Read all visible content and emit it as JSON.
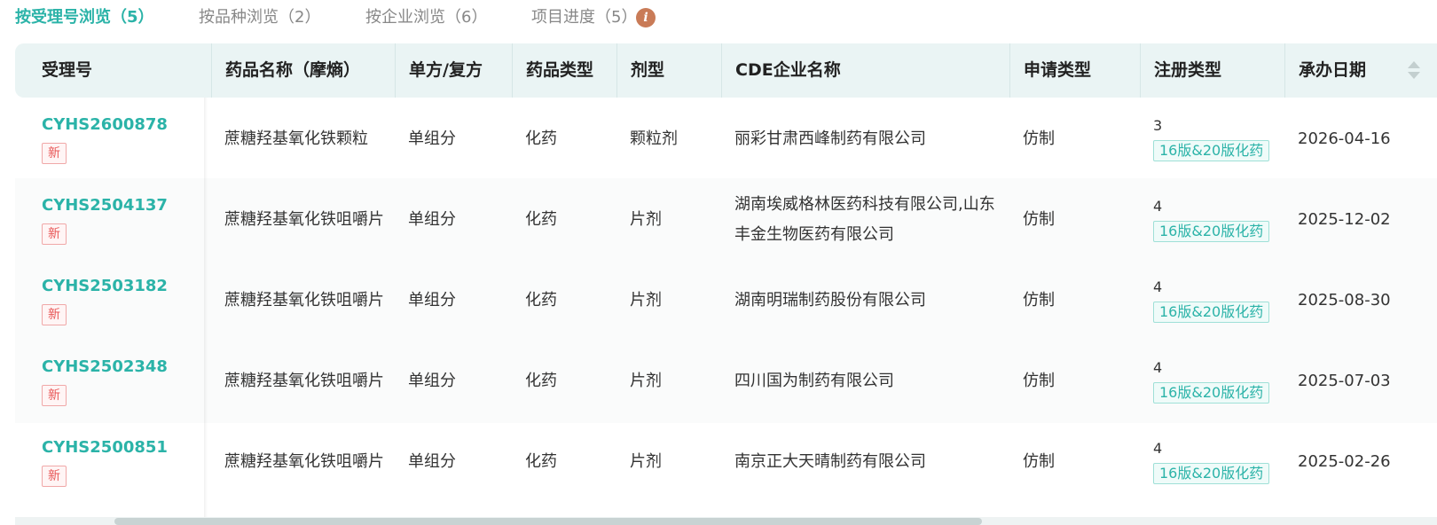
{
  "tabs": [
    {
      "label": "按受理号浏览（5）",
      "active": true
    },
    {
      "label": "按品种浏览（2）",
      "active": false
    },
    {
      "label": "按企业浏览（6）",
      "active": false
    },
    {
      "label": "项目进度（5）",
      "active": false
    }
  ],
  "info_icon": {
    "glyph": "i",
    "icon": "info-icon",
    "color": "#c97b57"
  },
  "table": {
    "columns": [
      "受理号",
      "药品名称（摩熵）",
      "单方/复方",
      "药品类型",
      "剂型",
      "CDE企业名称",
      "申请类型",
      "注册类型",
      "承办日期"
    ],
    "rows": [
      {
        "acceptance_no": "CYHS2600878",
        "badge": "新",
        "drug_name": "蔗糖羟基氧化铁颗粒",
        "composition": "单组分",
        "drug_type": "化药",
        "dosage_form": "颗粒剂",
        "company": "丽彩甘肃西峰制药有限公司",
        "application_type": "仿制",
        "reg_num": "3",
        "reg_tag": "16版&20版化药",
        "date": "2026-04-16"
      },
      {
        "acceptance_no": "CYHS2504137",
        "badge": "新",
        "drug_name": "蔗糖羟基氧化铁咀嚼片",
        "composition": "单组分",
        "drug_type": "化药",
        "dosage_form": "片剂",
        "company": "湖南埃威格林医药科技有限公司,山东丰金生物医药有限公司",
        "application_type": "仿制",
        "reg_num": "4",
        "reg_tag": "16版&20版化药",
        "date": "2025-12-02"
      },
      {
        "acceptance_no": "CYHS2503182",
        "badge": "新",
        "drug_name": "蔗糖羟基氧化铁咀嚼片",
        "composition": "单组分",
        "drug_type": "化药",
        "dosage_form": "片剂",
        "company": "湖南明瑞制药股份有限公司",
        "application_type": "仿制",
        "reg_num": "4",
        "reg_tag": "16版&20版化药",
        "date": "2025-08-30"
      },
      {
        "acceptance_no": "CYHS2502348",
        "badge": "新",
        "drug_name": "蔗糖羟基氧化铁咀嚼片",
        "composition": "单组分",
        "drug_type": "化药",
        "dosage_form": "片剂",
        "company": "四川国为制药有限公司",
        "application_type": "仿制",
        "reg_num": "4",
        "reg_tag": "16版&20版化药",
        "date": "2025-07-03"
      },
      {
        "acceptance_no": "CYHS2500851",
        "badge": "新",
        "drug_name": "蔗糖羟基氧化铁咀嚼片",
        "composition": "单组分",
        "drug_type": "化药",
        "dosage_form": "片剂",
        "company": "南京正大天晴制药有限公司",
        "application_type": "仿制",
        "reg_num": "4",
        "reg_tag": "16版&20版化药",
        "date": "2025-02-26"
      }
    ]
  },
  "colors": {
    "accent": "#2bb3a8",
    "new_badge": "#e85757",
    "header_bg": "#eaf4f4"
  }
}
